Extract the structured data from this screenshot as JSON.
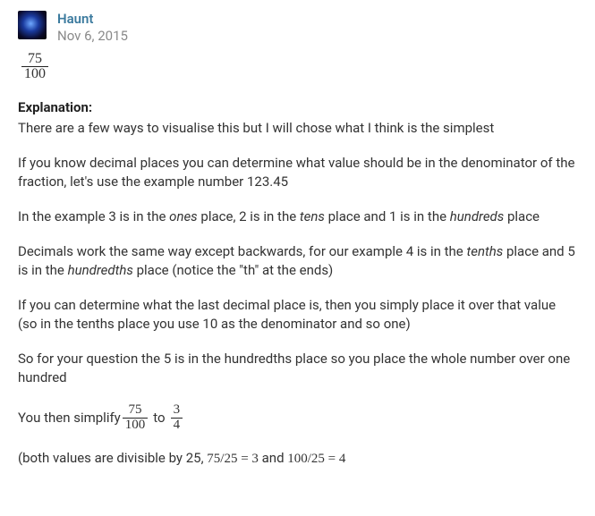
{
  "author": {
    "name": "Haunt",
    "date": "Nov 6, 2015"
  },
  "answer_fraction": {
    "num": "75",
    "den": "100"
  },
  "labels": {
    "explanation": "Explanation:"
  },
  "paragraphs": {
    "p1": "There are a few ways to visualise this but I will chose what I think is the simplest",
    "p2": "If you know decimal places you can determine what value should be in the denominator of the fraction, let's use the example number 123.45",
    "p3a": "In the example 3 is in the ",
    "p3b": " place, 2 is in the ",
    "p3c": " place and 1 is in the ",
    "p3d": " place",
    "place_ones": "ones",
    "place_tens": "tens",
    "place_hundreds": "hundreds",
    "p4a": "Decimals work the same way except backwards, for our example 4 is in the ",
    "p4b": " place and 5 is in the ",
    "p4c": " place (notice the \"th\" at the ends)",
    "place_tenths": "tenths",
    "place_hundredths": "hundredths",
    "p5": "If you can determine what the last decimal place is, then you simply place it over that value (so in the tenths place you use 10 as the denominator and so one)",
    "p6": "So for your question the 5 is in the hundredths place so you place the whole number over one hundred",
    "p7a": "You then simplify ",
    "p7b": " to ",
    "frac1": {
      "num": "75",
      "den": "100"
    },
    "frac2": {
      "num": "3",
      "den": "4"
    },
    "p8a": "(both values are divisible by 25, ",
    "p8b": " and ",
    "eq1": "75/25 = 3",
    "eq2": "100/25 = 4"
  }
}
